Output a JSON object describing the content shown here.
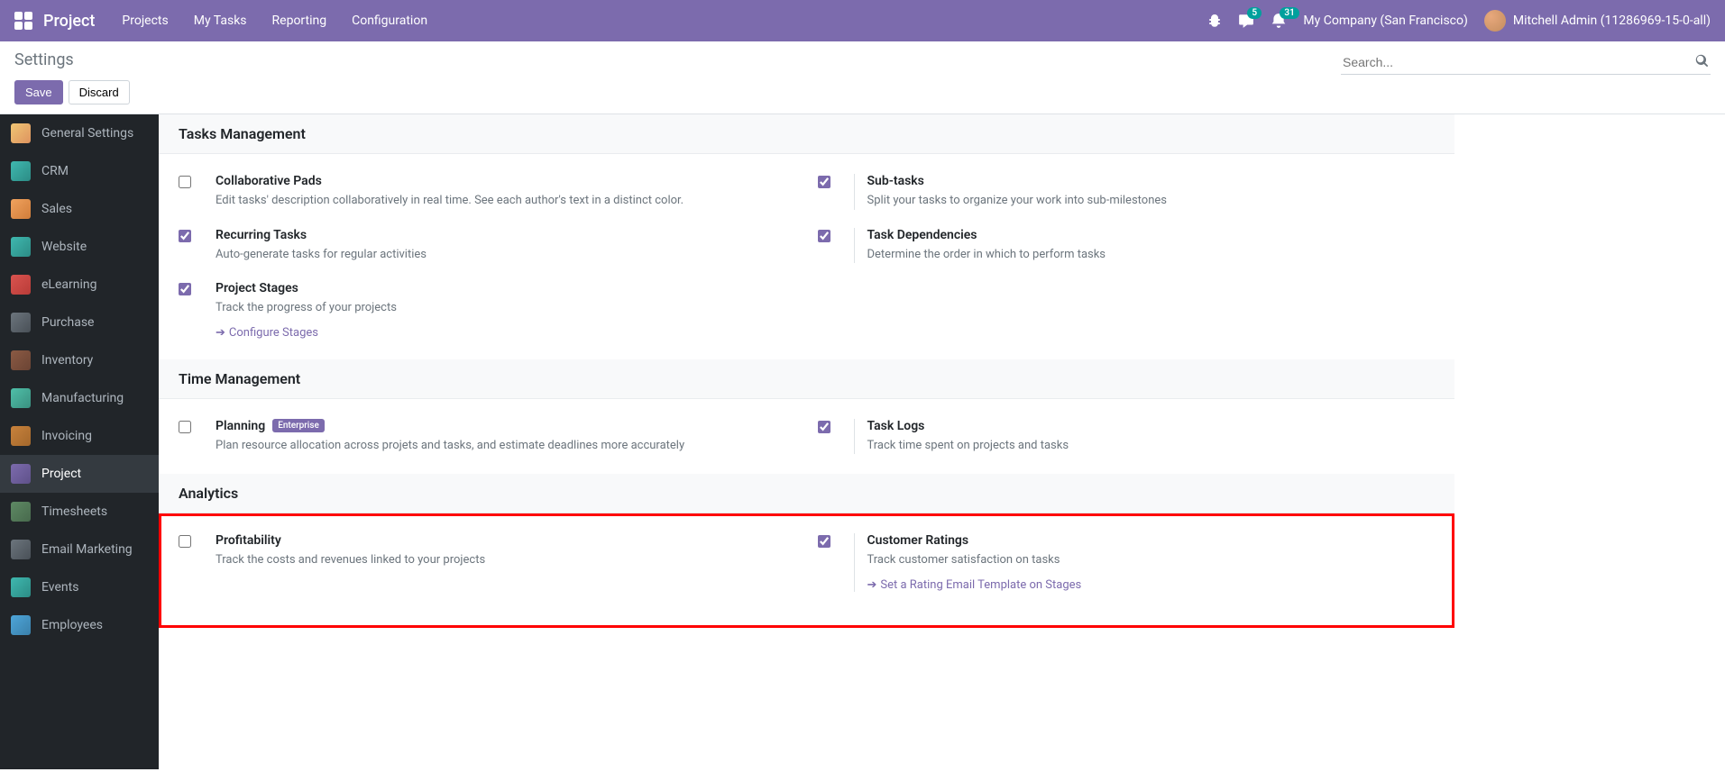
{
  "topnav": {
    "brand": "Project",
    "menu": [
      "Projects",
      "My Tasks",
      "Reporting",
      "Configuration"
    ],
    "messages_badge": "5",
    "activities_badge": "31",
    "company": "My Company (San Francisco)",
    "user": "Mitchell Admin (11286969-15-0-all)"
  },
  "controlpanel": {
    "title": "Settings",
    "save": "Save",
    "discard": "Discard",
    "search_placeholder": "Search..."
  },
  "sidebar": {
    "items": [
      {
        "label": "General Settings"
      },
      {
        "label": "CRM"
      },
      {
        "label": "Sales"
      },
      {
        "label": "Website"
      },
      {
        "label": "eLearning"
      },
      {
        "label": "Purchase"
      },
      {
        "label": "Inventory"
      },
      {
        "label": "Manufacturing"
      },
      {
        "label": "Invoicing"
      },
      {
        "label": "Project"
      },
      {
        "label": "Timesheets"
      },
      {
        "label": "Email Marketing"
      },
      {
        "label": "Events"
      },
      {
        "label": "Employees"
      }
    ]
  },
  "sections": {
    "tasks": {
      "header": "Tasks Management",
      "collab_pads": {
        "title": "Collaborative Pads",
        "desc": "Edit tasks' description collaboratively in real time. See each author's text in a distinct color."
      },
      "subtasks": {
        "title": "Sub-tasks",
        "desc": "Split your tasks to organize your work into sub-milestones"
      },
      "recurring": {
        "title": "Recurring Tasks",
        "desc": "Auto-generate tasks for regular activities"
      },
      "dependencies": {
        "title": "Task Dependencies",
        "desc": "Determine the order in which to perform tasks"
      },
      "stages": {
        "title": "Project Stages",
        "desc": "Track the progress of your projects",
        "link": "Configure Stages"
      }
    },
    "time": {
      "header": "Time Management",
      "planning": {
        "title": "Planning",
        "tag": "Enterprise",
        "desc": "Plan resource allocation across projets and tasks, and estimate deadlines more accurately"
      },
      "tasklogs": {
        "title": "Task Logs",
        "desc": "Track time spent on projects and tasks"
      }
    },
    "analytics": {
      "header": "Analytics",
      "profit": {
        "title": "Profitability",
        "desc": "Track the costs and revenues linked to your projects"
      },
      "ratings": {
        "title": "Customer Ratings",
        "desc": "Track customer satisfaction on tasks",
        "link": "Set a Rating Email Template on Stages"
      }
    }
  }
}
